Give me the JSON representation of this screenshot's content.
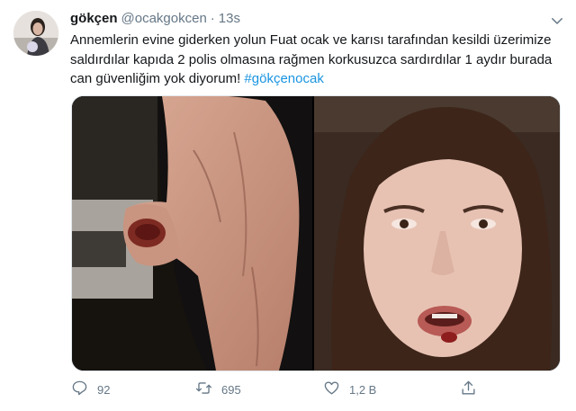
{
  "tweet": {
    "display_name": "gökçen",
    "handle": "@ocakgokcen",
    "separator": "·",
    "time": "13s",
    "text_body": "Annemlerin evine giderken yolun Fuat ocak ve karısı tarafından kesildi üzerimize saldırdılar kapıda 2 polis olmasına rağmen korkusuzca sardırdılar 1 aydır burada can güvenliğim yok diyorum! ",
    "hashtag": "#gökçenocak"
  },
  "actions": {
    "reply_count": "92",
    "retweet_count": "695",
    "like_count": "1,2 B"
  },
  "colors": {
    "text": "#14171a",
    "secondary": "#657786",
    "link": "#1b95e0",
    "border": "#e1e8ed"
  },
  "icons": [
    "chevron-down-icon",
    "reply-icon",
    "retweet-icon",
    "like-icon",
    "share-icon"
  ]
}
